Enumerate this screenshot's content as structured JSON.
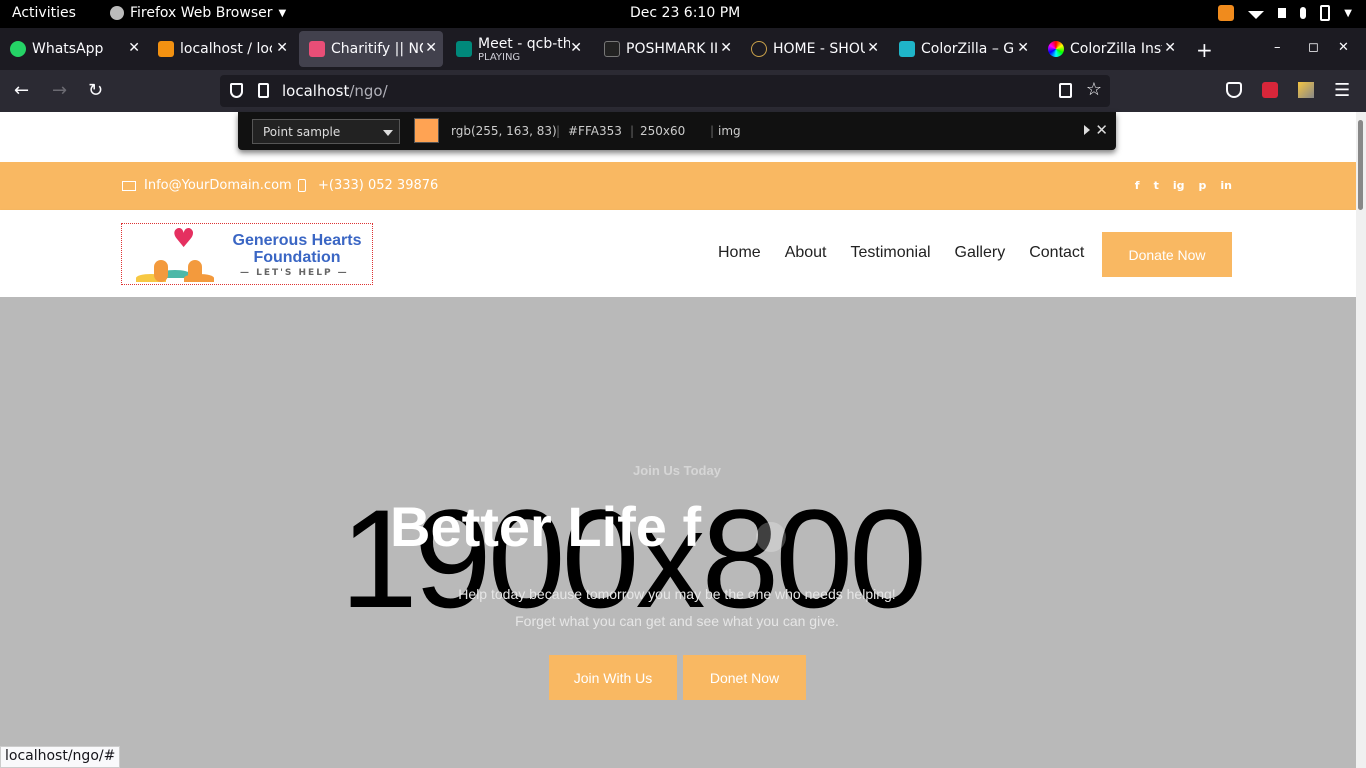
{
  "gnome": {
    "activities": "Activities",
    "app_menu": "Firefox Web Browser",
    "clock": "Dec 23  6:10 PM"
  },
  "tabs": [
    {
      "label": "WhatsApp",
      "sub": "",
      "favicon_color": "#25d366"
    },
    {
      "label": "localhost / loc",
      "sub": "",
      "favicon_color": "#f29111"
    },
    {
      "label": "Charitify || NG",
      "sub": "",
      "favicon_color": "#e94e77"
    },
    {
      "label": "Meet - qcb-th",
      "sub": "PLAYING",
      "favicon_color": "#00897b"
    },
    {
      "label": "POSHMARK II",
      "sub": "",
      "favicon_color": "#222222"
    },
    {
      "label": "HOME - SHOU",
      "sub": "",
      "favicon_color": "#c9a14a"
    },
    {
      "label": "ColorZilla – Ge",
      "sub": "",
      "favicon_color": "#1fb5c9"
    },
    {
      "label": "ColorZilla Inst",
      "sub": "",
      "favicon_color": "#a855f7"
    }
  ],
  "browser": {
    "url_host": "localhost",
    "url_path": "/ngo/",
    "status_url": "localhost/ngo/#"
  },
  "colorzilla": {
    "mode": "Point sample",
    "swatch": "#FFA353",
    "rgb": "rgb(255, 163, 83)",
    "hex": "#FFA353",
    "size": "250x60",
    "tag": "img"
  },
  "site": {
    "email": "Info@YourDomain.com",
    "phone": "+(333) 052 39876",
    "socials": [
      "f",
      "t",
      "ig",
      "p",
      "in"
    ],
    "logo": {
      "title": "Generous Hearts Foundation",
      "subtitle": "— LET'S HELP —"
    },
    "nav": [
      "Home",
      "About",
      "Testimonial",
      "Gallery",
      "Contact"
    ],
    "donate": "Donate Now",
    "hero": {
      "placeholder": "1900x800",
      "eyebrow": "Join Us Today",
      "headline": "Better Life f",
      "tagline1": "Help today because tomorrow you may be the one who needs helping!",
      "tagline2": "Forget what you can get and see what you can give.",
      "btn1": "Join With Us",
      "btn2": "Donet Now"
    }
  },
  "colors": {
    "accent": "#f9b862",
    "logo_blue": "#3a66c4",
    "heart": "#e53060"
  }
}
